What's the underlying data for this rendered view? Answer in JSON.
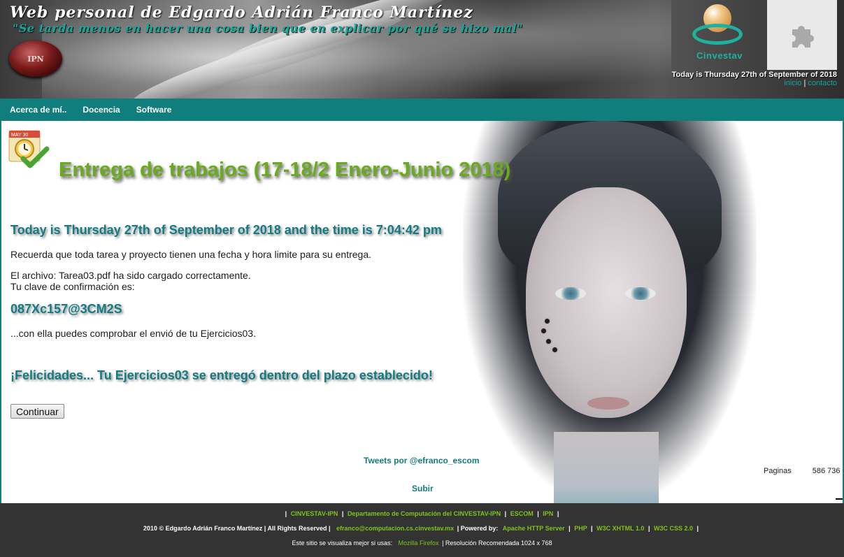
{
  "header": {
    "title": "Web personal de Edgardo Adrián Franco Martínez",
    "motto": "\"Se tarda menos en hacer una cosa bien que en explicar por qué se hizo mal\"",
    "ipn_logo_text": "IPN",
    "cinvestav_label": "Cinvestav",
    "date_text": "Today is Thursday 27th of September of 2018",
    "link_inicio": "inicio",
    "link_separator": "|",
    "link_contacto": "contacto"
  },
  "nav": {
    "items": [
      "Acerca de mí..",
      "Docencia",
      "Software"
    ]
  },
  "main": {
    "page_title": "Entrega de trabajos (17-18/2 Enero-Junio 2018)",
    "calendar_badge": "MAY 30",
    "today_line": "Today is Thursday 27th of September of 2018 and the time is 7:04:42 pm",
    "reminder": "Recuerda que toda tarea y proyecto tienen una fecha y hora limite para su entrega.",
    "file_uploaded": "El archivo: Tarea03.pdf ha sido cargado correctamente.",
    "confirm_label": "Tu clave de confirmación es:",
    "confirm_code": "087Xc157@3CM2S",
    "verify_text": "...con ella puedes comprobar el envió de tu Ejercicios03.",
    "congrats": "¡Felicidades... Tu Ejercicios03 se entregó dentro del plazo establecido!",
    "continue_button": "Continuar",
    "tweets_link": "Tweets por @efranco_escom",
    "counter_label": "Paginas",
    "counter_value": "586 736",
    "subir_link": "Subir"
  },
  "footer": {
    "row1_links": [
      "CINVESTAV-IPN",
      "Departamento de Computación del CINVESTAV-IPN",
      "ESCOM",
      "IPN"
    ],
    "copyright": "2010 © Edgardo Adrián Franco Martínez | All Rights Reserved |",
    "email": "efranco@computacion.cs.cinvestav.mx",
    "powered_by": "| Powered by:",
    "powered_links": [
      "Apache HTTP Server",
      "PHP",
      "W3C XHTML 1.0",
      "W3C CSS 2.0"
    ],
    "best_viewed": "Este sitio se visualiza mejor si usas:",
    "browser_link": "Mozilla Firefox",
    "resolution": "| Resolución Recomendada 1024 x 768",
    "separator": "|"
  },
  "colors": {
    "teal_nav": "#107e7d",
    "title_green": "#6aab1e",
    "heading_teal": "#147b83",
    "footer_bg": "#333333",
    "footer_link": "#7fc31c"
  },
  "icons": {
    "plugin": "puzzle-piece-icon",
    "page": "calendar-clock-check-icon"
  }
}
